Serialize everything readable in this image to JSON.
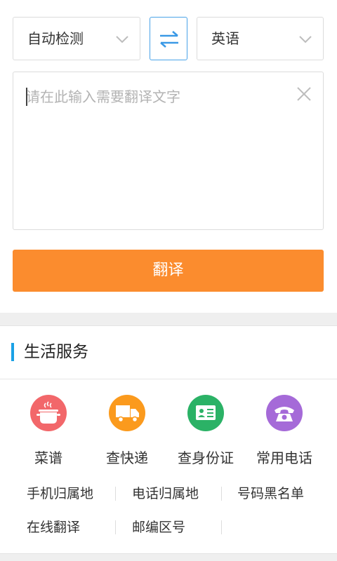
{
  "translator": {
    "source_language": "自动检测",
    "target_language": "英语",
    "input_placeholder": "请在此输入需要翻译文字",
    "translate_label": "翻译",
    "accent_color": "#fb8c2e",
    "swap_color": "#3a99e6"
  },
  "life_services": {
    "title": "生活服务",
    "icons": [
      {
        "label": "菜谱",
        "icon": "cooking-pot-icon",
        "color": "#f2676a"
      },
      {
        "label": "查快递",
        "icon": "delivery-truck-icon",
        "color": "#fb9a1d"
      },
      {
        "label": "查身份证",
        "icon": "id-card-icon",
        "color": "#2bb266"
      },
      {
        "label": "常用电话",
        "icon": "telephone-icon",
        "color": "#a56ad8"
      }
    ],
    "links": [
      "手机归属地",
      "电话归属地",
      "号码黑名单",
      "在线翻译",
      "邮编区号"
    ]
  }
}
